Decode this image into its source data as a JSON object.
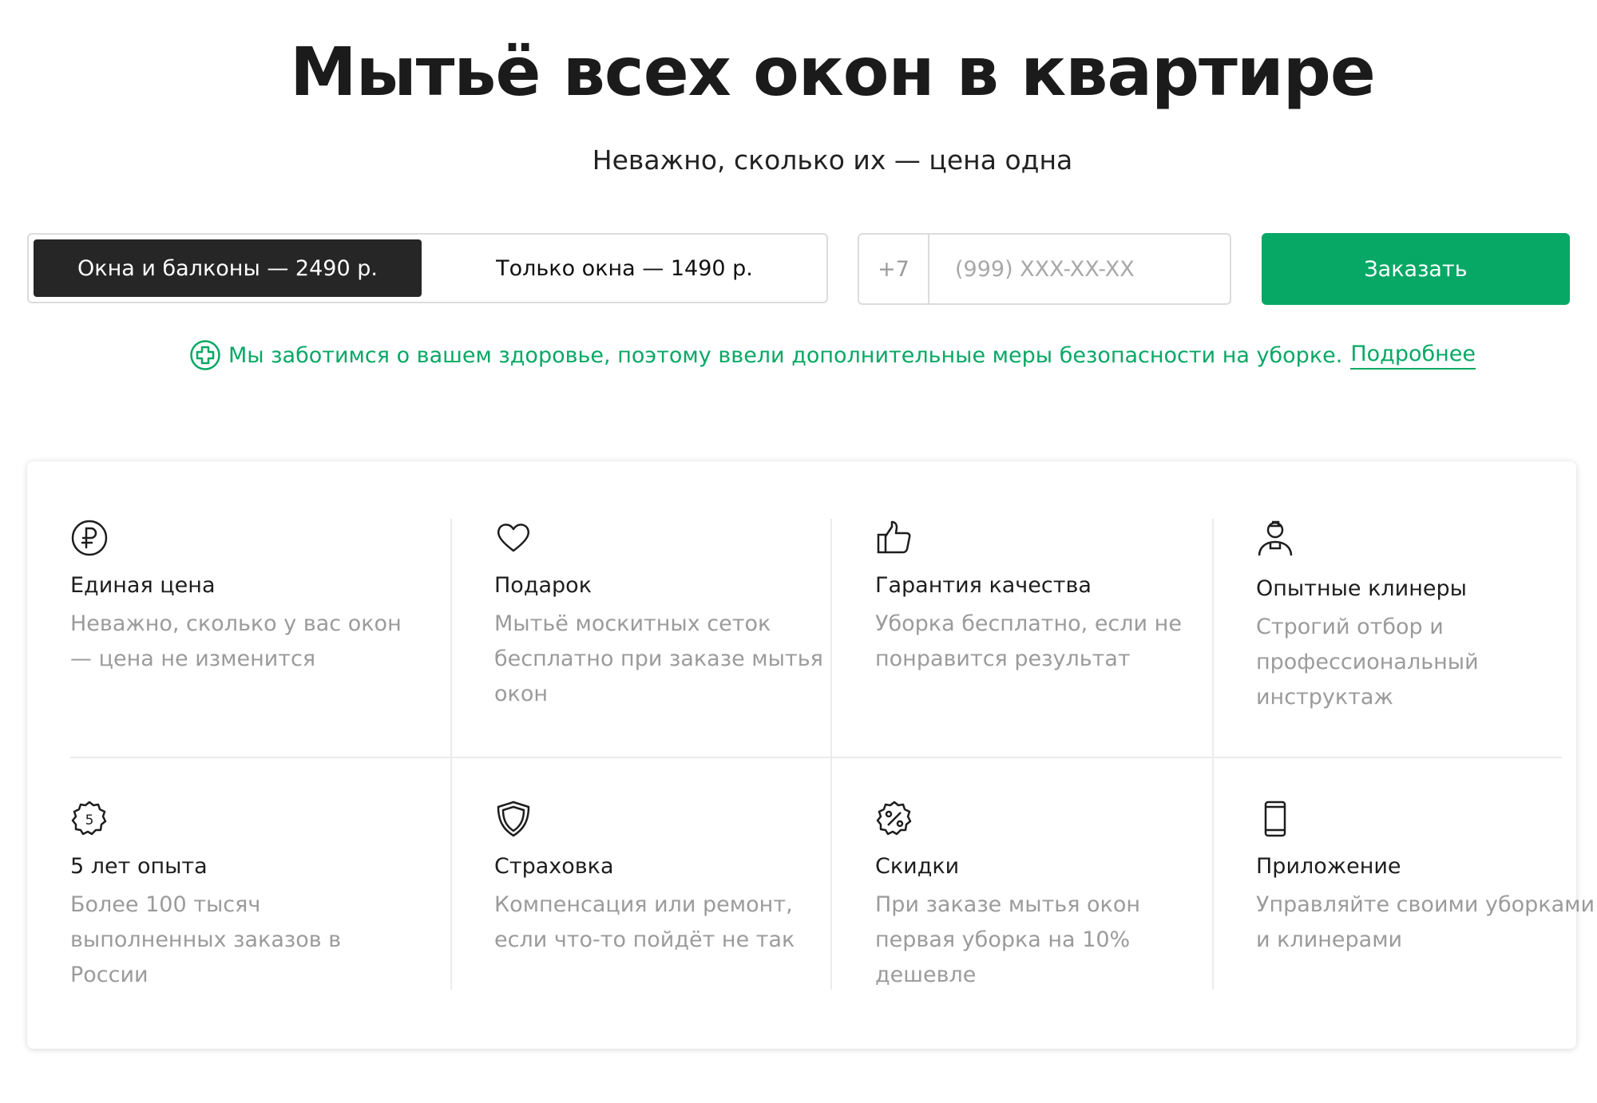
{
  "hero": {
    "title": "Мытьё всех окон в квартире",
    "subtitle": "Неважно, сколько их — цена одна"
  },
  "order_form": {
    "options": [
      {
        "label": "Окна и балконы — 2490 р.",
        "selected": true
      },
      {
        "label": "Только окна — 1490 р.",
        "selected": false
      }
    ],
    "phone_prefix": "+7",
    "phone_placeholder": "(999) XXX-XX-XX",
    "phone_value": "",
    "submit_label": "Заказать"
  },
  "notice": {
    "icon": "plus-circle-icon",
    "text": "Мы заботимся о вашем здоровье, поэтому ввели дополнительные меры безопасности на уборке.",
    "link_label": "Подробнее"
  },
  "features": [
    {
      "icon": "ruble-icon",
      "title": "Единая цена",
      "description": "Неважно, сколько у вас окон — цена не изменится"
    },
    {
      "icon": "heart-icon",
      "title": "Подарок",
      "description": "Мытьё москитных сеток бесплатно при заказе мытья окон"
    },
    {
      "icon": "thumbs-up-icon",
      "title": "Гарантия качества",
      "description": "Уборка бесплатно, если не понравится результат"
    },
    {
      "icon": "cleaner-icon",
      "title": "Опытные клинеры",
      "description": "Строгий отбор и профессиональный инструктаж"
    },
    {
      "icon": "badge-five-icon",
      "badge_text": "5",
      "title": "5 лет опыта",
      "description": "Более 100 тысяч выполненных заказов в России"
    },
    {
      "icon": "shield-icon",
      "title": "Страховка",
      "description": "Компенсация или ремонт, если что-то пойдёт не так"
    },
    {
      "icon": "discount-badge-icon",
      "title": "Скидки",
      "description": "При заказе мытья окон первая уборка на 10% дешевле"
    },
    {
      "icon": "smartphone-icon",
      "title": "Приложение",
      "description": "Управляйте своими уборками и клинерами"
    }
  ],
  "colors": {
    "accent": "#07a865",
    "selected_option_bg": "#262626",
    "muted_text": "#9b9b9b",
    "border": "#dcdcdc"
  }
}
